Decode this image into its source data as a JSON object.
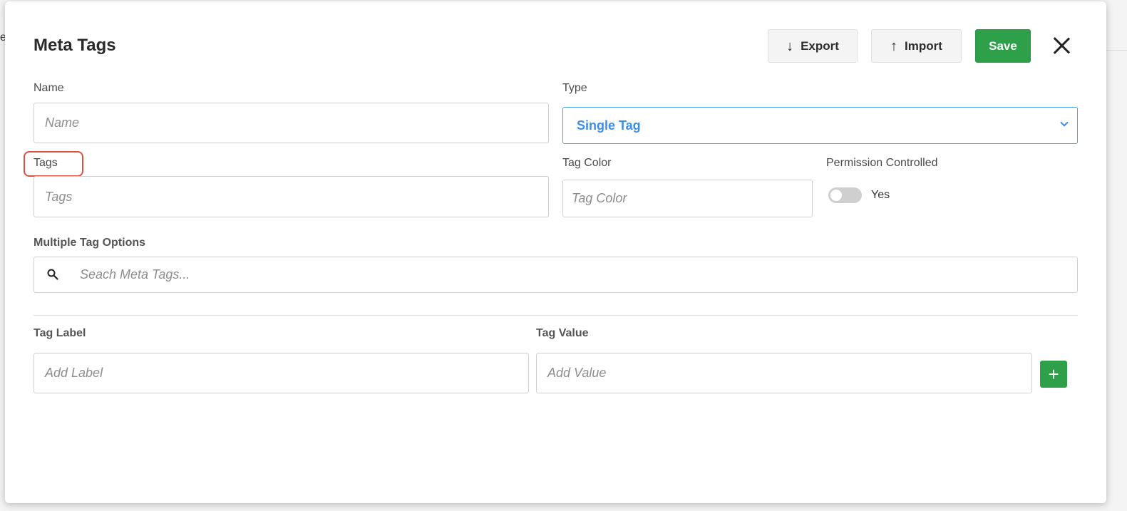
{
  "background": {
    "fragment_text": "e"
  },
  "modal": {
    "title": "Meta Tags",
    "buttons": {
      "export_label": "Export",
      "export_icon": "arrow-down-icon",
      "import_label": "Import",
      "import_icon": "arrow-up-icon",
      "save_label": "Save",
      "close_icon": "close-icon"
    },
    "fields": {
      "name": {
        "label": "Name",
        "placeholder": "Name"
      },
      "type": {
        "label": "Type",
        "value": "Single Tag"
      },
      "tags": {
        "label": "Tags",
        "placeholder": "Tags"
      },
      "tag_color": {
        "label": "Tag Color",
        "placeholder": "Tag Color"
      },
      "permission": {
        "label": "Permission Controlled",
        "toggle_label": "Yes",
        "enabled": false
      },
      "multiple_options": {
        "label": "Multiple Tag Options",
        "placeholder": "Seach Meta Tags..."
      },
      "tag_label": {
        "label": "Tag Label",
        "placeholder": "Add Label"
      },
      "tag_value": {
        "label": "Tag Value",
        "placeholder": "Add Value"
      },
      "add_button": "+"
    }
  },
  "colors": {
    "accent_blue": "#3b8fe8",
    "save_green": "#2ea04a",
    "highlight_red": "#d9533f"
  }
}
